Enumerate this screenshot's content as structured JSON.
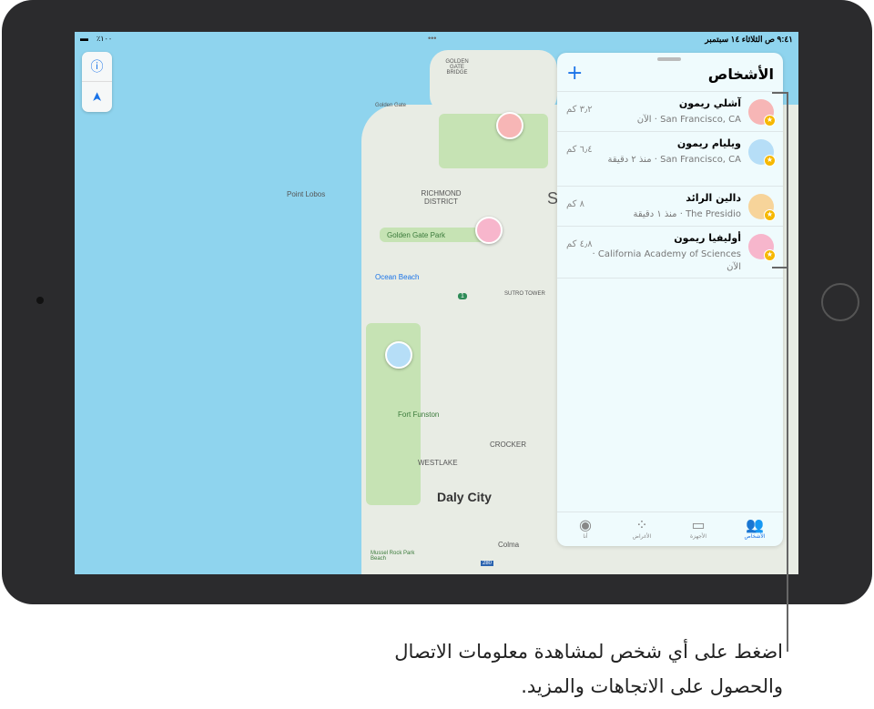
{
  "status_bar": {
    "time_date": "٩:٤١ ص الثلاثاء ١٤ سبتمبر",
    "battery": "٪١٠٠",
    "dots": "•••"
  },
  "map": {
    "labels": [
      "GOLDEN GATE BRIDGE",
      "Golden Gate",
      "Point Lobos",
      "RICHMOND DISTRICT",
      "Golden Gate Park",
      "Ocean Beach",
      "SUTRO TOWER",
      "Fort Funston",
      "CROCKER",
      "WESTLAKE",
      "Daly City",
      "Colma",
      "Mussel Rock Park Beach",
      "280",
      "1",
      "S"
    ]
  },
  "controls": {
    "info": "ⓘ",
    "location": "➤"
  },
  "panel": {
    "title": "الأشخاص",
    "add": "+",
    "people": [
      {
        "name": "آشلي ريمون",
        "location": "San Francisco, CA",
        "time": "الآن",
        "distance": "٣٫٢ كم",
        "color": "#f7b6b6"
      },
      {
        "name": "ويليام ريمون",
        "location": "San Francisco, CA",
        "time": "منذ ٢ دقيقة",
        "distance": "٦٫٤ كم",
        "color": "#b6def7"
      },
      {
        "name": "دالين الرائد",
        "location": "The Presidio",
        "time": "منذ ١ دقيقة",
        "distance": "٨ كم",
        "color": "#f7d49a"
      },
      {
        "name": "أوليفيا ريمون",
        "location": "California Academy of Sciences",
        "time": "الآن",
        "distance": "٤٫٨ كم",
        "color": "#f7b6cc"
      }
    ],
    "tabs": [
      {
        "label": "الأشخاص",
        "icon": "people-icon",
        "active": true
      },
      {
        "label": "الأجهزة",
        "icon": "devices-icon"
      },
      {
        "label": "الأغراض",
        "icon": "items-icon"
      },
      {
        "label": "أنا",
        "icon": "me-icon"
      }
    ]
  },
  "caption": "اضغط على أي شخص لمشاهدة معلومات الاتصال والحصول على الاتجاهات والمزيد.",
  "accent": "#1a73e8"
}
